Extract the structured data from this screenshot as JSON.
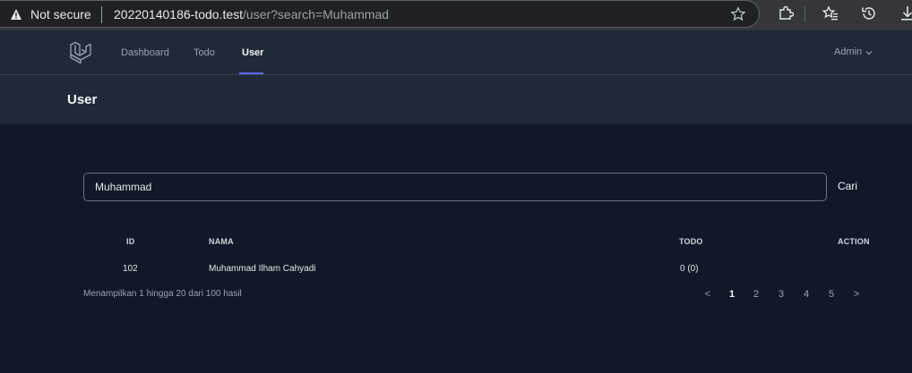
{
  "browser": {
    "security_label": "Not secure",
    "url_host": "20220140186-todo.test",
    "url_path": "/user?search=Muhammad"
  },
  "nav": {
    "links": [
      "Dashboard",
      "Todo",
      "User"
    ],
    "active": "User",
    "user_menu": "Admin"
  },
  "header": {
    "title": "User"
  },
  "search": {
    "value": "Muhammad",
    "button_label": "Cari"
  },
  "table": {
    "columns": [
      "ID",
      "NAMA",
      "TODO",
      "ACTION"
    ],
    "rows": [
      {
        "id": "102",
        "nama": "Muhammad Ilham Cahyadi",
        "todo": "0 (0)",
        "action": ""
      }
    ]
  },
  "pagination": {
    "summary": "Menampilkan 1 hingga 20 dari 100 hasil",
    "prev": "<",
    "pages": [
      "1",
      "2",
      "3",
      "4",
      "5"
    ],
    "current": "1",
    "next": ">"
  },
  "colors": {
    "accent": "#6366f1",
    "background": "#111827",
    "panel": "#1f2937"
  }
}
